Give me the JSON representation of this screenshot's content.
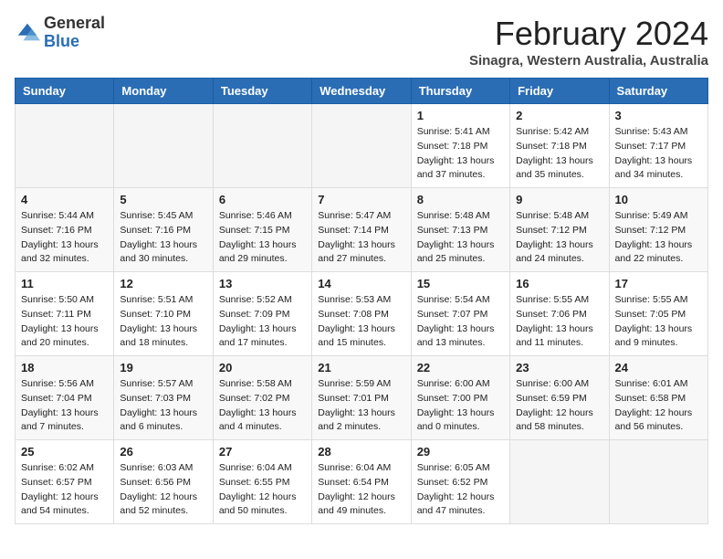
{
  "header": {
    "logo_general": "General",
    "logo_blue": "Blue",
    "month_title": "February 2024",
    "location": "Sinagra, Western Australia, Australia"
  },
  "days_of_week": [
    "Sunday",
    "Monday",
    "Tuesday",
    "Wednesday",
    "Thursday",
    "Friday",
    "Saturday"
  ],
  "weeks": [
    [
      {
        "day": "",
        "info": ""
      },
      {
        "day": "",
        "info": ""
      },
      {
        "day": "",
        "info": ""
      },
      {
        "day": "",
        "info": ""
      },
      {
        "day": "1",
        "info": "Sunrise: 5:41 AM\nSunset: 7:18 PM\nDaylight: 13 hours\nand 37 minutes."
      },
      {
        "day": "2",
        "info": "Sunrise: 5:42 AM\nSunset: 7:18 PM\nDaylight: 13 hours\nand 35 minutes."
      },
      {
        "day": "3",
        "info": "Sunrise: 5:43 AM\nSunset: 7:17 PM\nDaylight: 13 hours\nand 34 minutes."
      }
    ],
    [
      {
        "day": "4",
        "info": "Sunrise: 5:44 AM\nSunset: 7:16 PM\nDaylight: 13 hours\nand 32 minutes."
      },
      {
        "day": "5",
        "info": "Sunrise: 5:45 AM\nSunset: 7:16 PM\nDaylight: 13 hours\nand 30 minutes."
      },
      {
        "day": "6",
        "info": "Sunrise: 5:46 AM\nSunset: 7:15 PM\nDaylight: 13 hours\nand 29 minutes."
      },
      {
        "day": "7",
        "info": "Sunrise: 5:47 AM\nSunset: 7:14 PM\nDaylight: 13 hours\nand 27 minutes."
      },
      {
        "day": "8",
        "info": "Sunrise: 5:48 AM\nSunset: 7:13 PM\nDaylight: 13 hours\nand 25 minutes."
      },
      {
        "day": "9",
        "info": "Sunrise: 5:48 AM\nSunset: 7:12 PM\nDaylight: 13 hours\nand 24 minutes."
      },
      {
        "day": "10",
        "info": "Sunrise: 5:49 AM\nSunset: 7:12 PM\nDaylight: 13 hours\nand 22 minutes."
      }
    ],
    [
      {
        "day": "11",
        "info": "Sunrise: 5:50 AM\nSunset: 7:11 PM\nDaylight: 13 hours\nand 20 minutes."
      },
      {
        "day": "12",
        "info": "Sunrise: 5:51 AM\nSunset: 7:10 PM\nDaylight: 13 hours\nand 18 minutes."
      },
      {
        "day": "13",
        "info": "Sunrise: 5:52 AM\nSunset: 7:09 PM\nDaylight: 13 hours\nand 17 minutes."
      },
      {
        "day": "14",
        "info": "Sunrise: 5:53 AM\nSunset: 7:08 PM\nDaylight: 13 hours\nand 15 minutes."
      },
      {
        "day": "15",
        "info": "Sunrise: 5:54 AM\nSunset: 7:07 PM\nDaylight: 13 hours\nand 13 minutes."
      },
      {
        "day": "16",
        "info": "Sunrise: 5:55 AM\nSunset: 7:06 PM\nDaylight: 13 hours\nand 11 minutes."
      },
      {
        "day": "17",
        "info": "Sunrise: 5:55 AM\nSunset: 7:05 PM\nDaylight: 13 hours\nand 9 minutes."
      }
    ],
    [
      {
        "day": "18",
        "info": "Sunrise: 5:56 AM\nSunset: 7:04 PM\nDaylight: 13 hours\nand 7 minutes."
      },
      {
        "day": "19",
        "info": "Sunrise: 5:57 AM\nSunset: 7:03 PM\nDaylight: 13 hours\nand 6 minutes."
      },
      {
        "day": "20",
        "info": "Sunrise: 5:58 AM\nSunset: 7:02 PM\nDaylight: 13 hours\nand 4 minutes."
      },
      {
        "day": "21",
        "info": "Sunrise: 5:59 AM\nSunset: 7:01 PM\nDaylight: 13 hours\nand 2 minutes."
      },
      {
        "day": "22",
        "info": "Sunrise: 6:00 AM\nSunset: 7:00 PM\nDaylight: 13 hours\nand 0 minutes."
      },
      {
        "day": "23",
        "info": "Sunrise: 6:00 AM\nSunset: 6:59 PM\nDaylight: 12 hours\nand 58 minutes."
      },
      {
        "day": "24",
        "info": "Sunrise: 6:01 AM\nSunset: 6:58 PM\nDaylight: 12 hours\nand 56 minutes."
      }
    ],
    [
      {
        "day": "25",
        "info": "Sunrise: 6:02 AM\nSunset: 6:57 PM\nDaylight: 12 hours\nand 54 minutes."
      },
      {
        "day": "26",
        "info": "Sunrise: 6:03 AM\nSunset: 6:56 PM\nDaylight: 12 hours\nand 52 minutes."
      },
      {
        "day": "27",
        "info": "Sunrise: 6:04 AM\nSunset: 6:55 PM\nDaylight: 12 hours\nand 50 minutes."
      },
      {
        "day": "28",
        "info": "Sunrise: 6:04 AM\nSunset: 6:54 PM\nDaylight: 12 hours\nand 49 minutes."
      },
      {
        "day": "29",
        "info": "Sunrise: 6:05 AM\nSunset: 6:52 PM\nDaylight: 12 hours\nand 47 minutes."
      },
      {
        "day": "",
        "info": ""
      },
      {
        "day": "",
        "info": ""
      }
    ]
  ]
}
